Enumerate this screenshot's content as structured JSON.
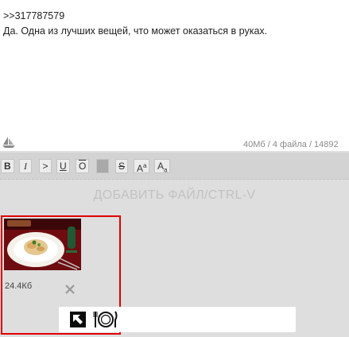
{
  "post": {
    "reply_ref": ">>317787579",
    "message": "Да. Одна из лучших вещей, что может оказаться в руках."
  },
  "stats_line": "40Мб / 4 файла / 14892 ",
  "toolbar": {
    "bold": "B",
    "italic": "I",
    "quote": ">",
    "underline": "U",
    "overline": "O",
    "strike": "S",
    "sup_base": "A",
    "sup_small": "a",
    "sub_base": "A",
    "sub_small": "a"
  },
  "dropzone_label": "ДОБАВИТЬ ФАЙЛ/CTRL-V",
  "attachment": {
    "size": "24.4Кб"
  },
  "icons": {
    "resize": "sailboat-icon",
    "remove": "close-icon",
    "arrow": "arrow-up-left-icon",
    "dish": "plate-cutlery-icon"
  },
  "colors": {
    "selection_border": "#e00000",
    "background": "#dedede"
  }
}
